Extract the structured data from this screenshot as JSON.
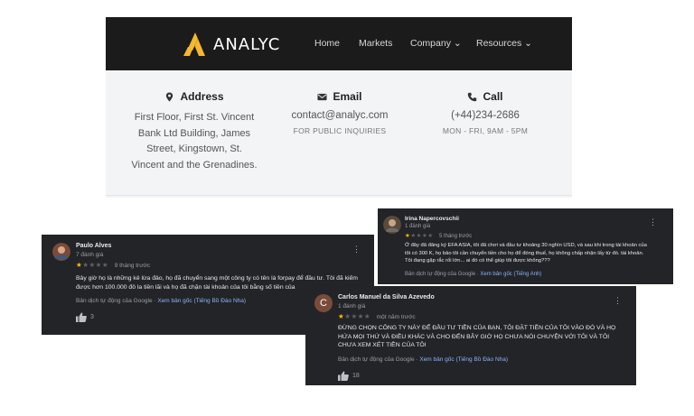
{
  "site": {
    "brand": "ANALYC",
    "nav": [
      "Home",
      "Markets",
      "Company",
      "Resources"
    ],
    "address": {
      "title": "Address",
      "lines": [
        "First Floor, First St. Vincent",
        "Bank Ltd Building, James",
        "Street, Kingstown, St.",
        "Vincent and the Grenadines."
      ]
    },
    "email": {
      "title": "Email",
      "value": "contact@analyc.com",
      "note": "FOR PUBLIC INQUIRIES"
    },
    "call": {
      "title": "Call",
      "value": "(+44)234-2686",
      "note": "MON - FRI, 9AM - 5PM"
    }
  },
  "reviews": [
    {
      "name": "Paulo Alves",
      "count": "7 đánh giá",
      "rating": 1,
      "when": "9 tháng trước",
      "lines": [
        "Bây giờ họ là những kẻ lừa đảo, họ đã chuyển sang một công ty có tên là forpay để đầu tư. Tôi đã kiếm",
        "được hơn 100.000 đô la tiền lãi và họ đã chặn tài khoản của tôi bằng số tiền của"
      ],
      "translated": "Bản dịch tự động của Google",
      "original": "Xem bản gốc (Tiếng Bồ Đào Nha)",
      "likes": "3"
    },
    {
      "name": "Irina Napercovschii",
      "count": "1 đánh giá",
      "rating": 1,
      "when": "5 tháng trước",
      "lines": [
        "Ở đây đã đăng ký EFA ASIA, tôi đã chơi và đầu tư khoảng 30 nghìn USD, và sau khi trong tài khoản của",
        "tôi có 300 K, họ bảo tôi cần chuyển tiền cho họ để đóng thuế, họ không chấp nhận lấy từ đó. tài khoản.",
        "Tôi đang gặp rắc rối lớn... ai đó có thể giúp tôi được không???"
      ],
      "translated": "Bản dịch tự động của Google",
      "original": "Xem bản gốc (Tiếng Anh)"
    },
    {
      "name": "Carlos Manuel da Silva Azevedo",
      "initial": "C",
      "count": "1 đánh giá",
      "rating": 1,
      "when": "một năm trước",
      "lines": [
        "ĐỪNG CHỌN CÔNG TY NÀY ĐỂ ĐẦU TƯ TIỀN CỦA BẠN, TÔI ĐẶT TIỀN CỦA TÔI VÀO ĐÓ VÀ HỌ",
        "HỨA MỌI THỨ VÀ ĐIỀU KHÁC VÀ CHO ĐẾN BÂY GIỜ HỌ CHƯA NÓI CHUYỆN VỚI TÔI VÀ TÔI",
        "CHƯA XEM XÉT TIỀN CỦA TÔI"
      ],
      "translated": "Bản dịch tự động của Google",
      "original": "Xem bản gốc (Tiếng Bồ Đào Nha)",
      "likes": "18"
    }
  ],
  "colors": {
    "nav_bg": "#1b1b1b",
    "logo_yellow": "#f5b82e",
    "review_bg": "#232427",
    "star": "#fbbc04",
    "link": "#8ab4f8"
  }
}
